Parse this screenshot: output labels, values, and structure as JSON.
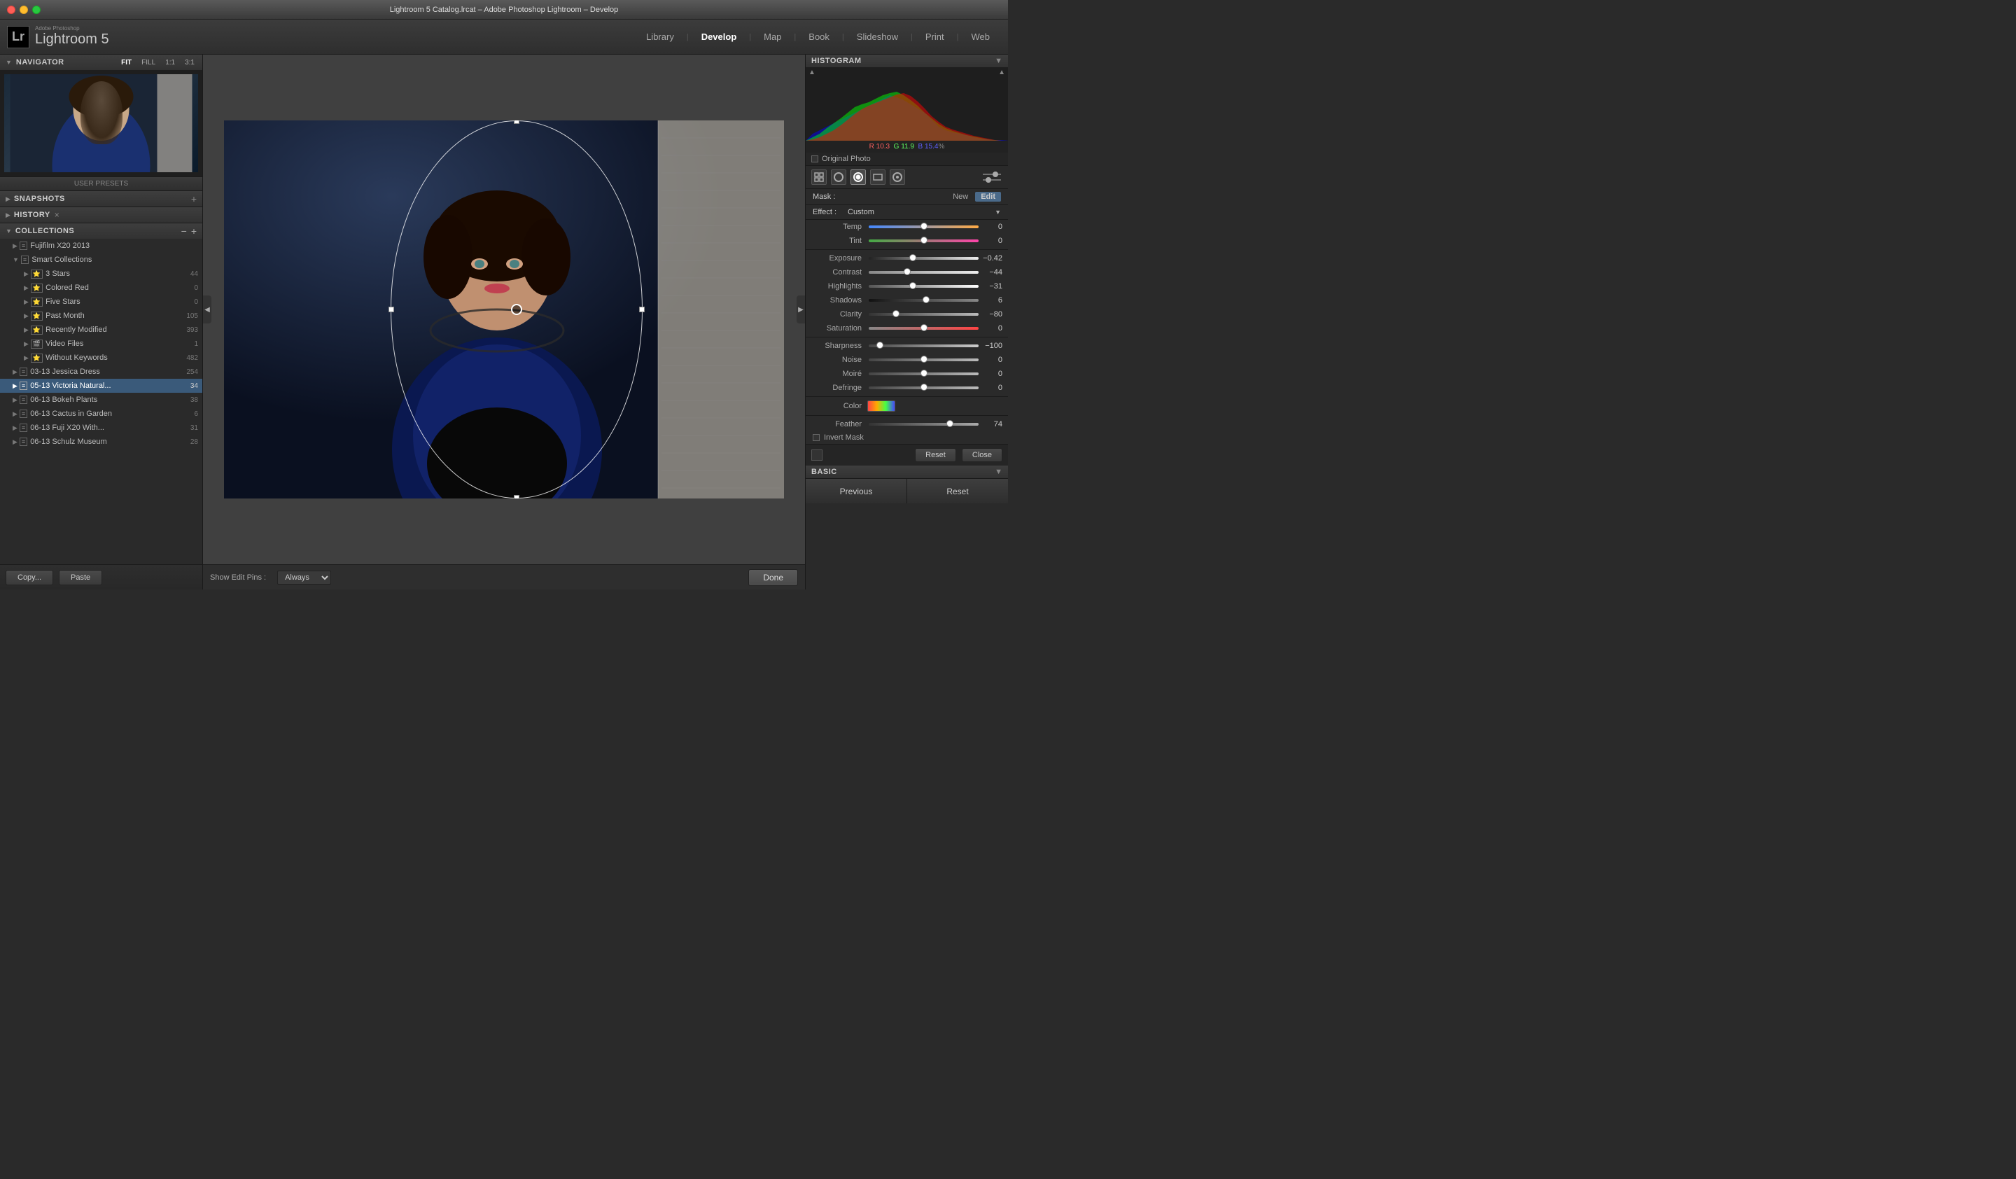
{
  "titlebar": {
    "title": "Lightroom 5 Catalog.lrcat – Adobe Photoshop Lightroom – Develop"
  },
  "menubar": {
    "logo_brand": "Adobe Photoshop",
    "app_name": "Lightroom 5",
    "lr_icon": "Lr",
    "nav_items": [
      {
        "label": "Library",
        "active": false
      },
      {
        "label": "Develop",
        "active": true
      },
      {
        "label": "Map",
        "active": false
      },
      {
        "label": "Book",
        "active": false
      },
      {
        "label": "Slideshow",
        "active": false
      },
      {
        "label": "Print",
        "active": false
      },
      {
        "label": "Web",
        "active": false
      }
    ]
  },
  "navigator": {
    "title": "Navigator",
    "zoom_options": [
      "FIT",
      "FILL",
      "1:1",
      "3:1"
    ]
  },
  "presets_label": "USER PRESETS",
  "snapshots": {
    "title": "Snapshots",
    "add_icon": "+"
  },
  "history": {
    "title": "History",
    "close_icon": "×"
  },
  "collections": {
    "title": "Collections",
    "minus_icon": "−",
    "add_icon": "+",
    "items": [
      {
        "indent": 1,
        "arrow": "▶",
        "icon": "📁",
        "label": "Fujifilm X20 2013",
        "count": ""
      },
      {
        "indent": 1,
        "arrow": "▼",
        "icon": "📁",
        "label": "Smart Collections",
        "count": ""
      },
      {
        "indent": 2,
        "arrow": "▶",
        "icon": "⭐",
        "label": "3 Stars",
        "count": "44"
      },
      {
        "indent": 2,
        "arrow": "▶",
        "icon": "⭐",
        "label": "Colored Red",
        "count": "0"
      },
      {
        "indent": 2,
        "arrow": "▶",
        "icon": "⭐",
        "label": "Five Stars",
        "count": "0"
      },
      {
        "indent": 2,
        "arrow": "▶",
        "icon": "⭐",
        "label": "Past Month",
        "count": "105"
      },
      {
        "indent": 2,
        "arrow": "▶",
        "icon": "⭐",
        "label": "Recently Modified",
        "count": "393"
      },
      {
        "indent": 2,
        "arrow": "▶",
        "icon": "🎬",
        "label": "Video Files",
        "count": "1"
      },
      {
        "indent": 2,
        "arrow": "▶",
        "icon": "⭐",
        "label": "Without Keywords",
        "count": "482"
      },
      {
        "indent": 1,
        "arrow": "▶",
        "icon": "📁",
        "label": "03-13 Jessica Dress",
        "count": "254"
      },
      {
        "indent": 1,
        "arrow": "▶",
        "icon": "📁",
        "label": "05-13 Victoria Natural...",
        "count": "34",
        "active": true
      },
      {
        "indent": 1,
        "arrow": "▶",
        "icon": "📁",
        "label": "06-13 Bokeh Plants",
        "count": "38"
      },
      {
        "indent": 1,
        "arrow": "▶",
        "icon": "📁",
        "label": "06-13 Cactus in Garden",
        "count": "6"
      },
      {
        "indent": 1,
        "arrow": "▶",
        "icon": "📁",
        "label": "06-13 Fuji X20 With...",
        "count": "31"
      },
      {
        "indent": 1,
        "arrow": "▶",
        "icon": "📁",
        "label": "06-13 Schulz Museum",
        "count": "28"
      }
    ]
  },
  "bottom_bar": {
    "copy_btn": "Copy...",
    "paste_btn": "Paste"
  },
  "image_footer": {
    "show_edit_pins_label": "Show Edit Pins :",
    "show_edit_pins_value": "Always",
    "done_btn": "Done"
  },
  "histogram": {
    "title": "Histogram",
    "r_value": "10.3",
    "g_value": "11.9",
    "b_value": "15.4",
    "r_label": "R",
    "g_label": "G",
    "b_label": "B",
    "percent": "%",
    "original_photo_label": "Original Photo"
  },
  "mask": {
    "label": "Mask :",
    "new_label": "New",
    "edit_label": "Edit"
  },
  "effect": {
    "label": "Effect :",
    "value": "Custom",
    "dropdown": "▼"
  },
  "sliders": {
    "temp": {
      "label": "Temp",
      "value": "0",
      "position": 50
    },
    "tint": {
      "label": "Tint",
      "value": "0",
      "position": 50
    },
    "exposure": {
      "label": "Exposure",
      "value": "−0.42",
      "position": 40
    },
    "contrast": {
      "label": "Contrast",
      "value": "−44",
      "position": 35
    },
    "highlights": {
      "label": "Highlights",
      "value": "−31",
      "position": 40
    },
    "shadows": {
      "label": "Shadows",
      "value": "6",
      "position": 52
    },
    "clarity": {
      "label": "Clarity",
      "value": "−80",
      "position": 25
    },
    "saturation": {
      "label": "Saturation",
      "value": "0",
      "position": 50
    },
    "sharpness": {
      "label": "Sharpness",
      "value": "−100",
      "position": 10
    },
    "noise": {
      "label": "Noise",
      "value": "0",
      "position": 50
    },
    "moire": {
      "label": "Moiré",
      "value": "0",
      "position": 50
    },
    "defringe": {
      "label": "Defringe",
      "value": "0",
      "position": 50
    },
    "feather": {
      "label": "Feather",
      "value": "74",
      "position": 74
    }
  },
  "color_section": {
    "label": "Color"
  },
  "invert_mask": {
    "label": "Invert Mask"
  },
  "right_buttons": {
    "reset_label": "Reset",
    "close_label": "Close"
  },
  "basic_section": {
    "title": "Basic",
    "dropdown": "▼"
  },
  "right_bottom": {
    "previous_label": "Previous",
    "reset_label": "Reset"
  }
}
